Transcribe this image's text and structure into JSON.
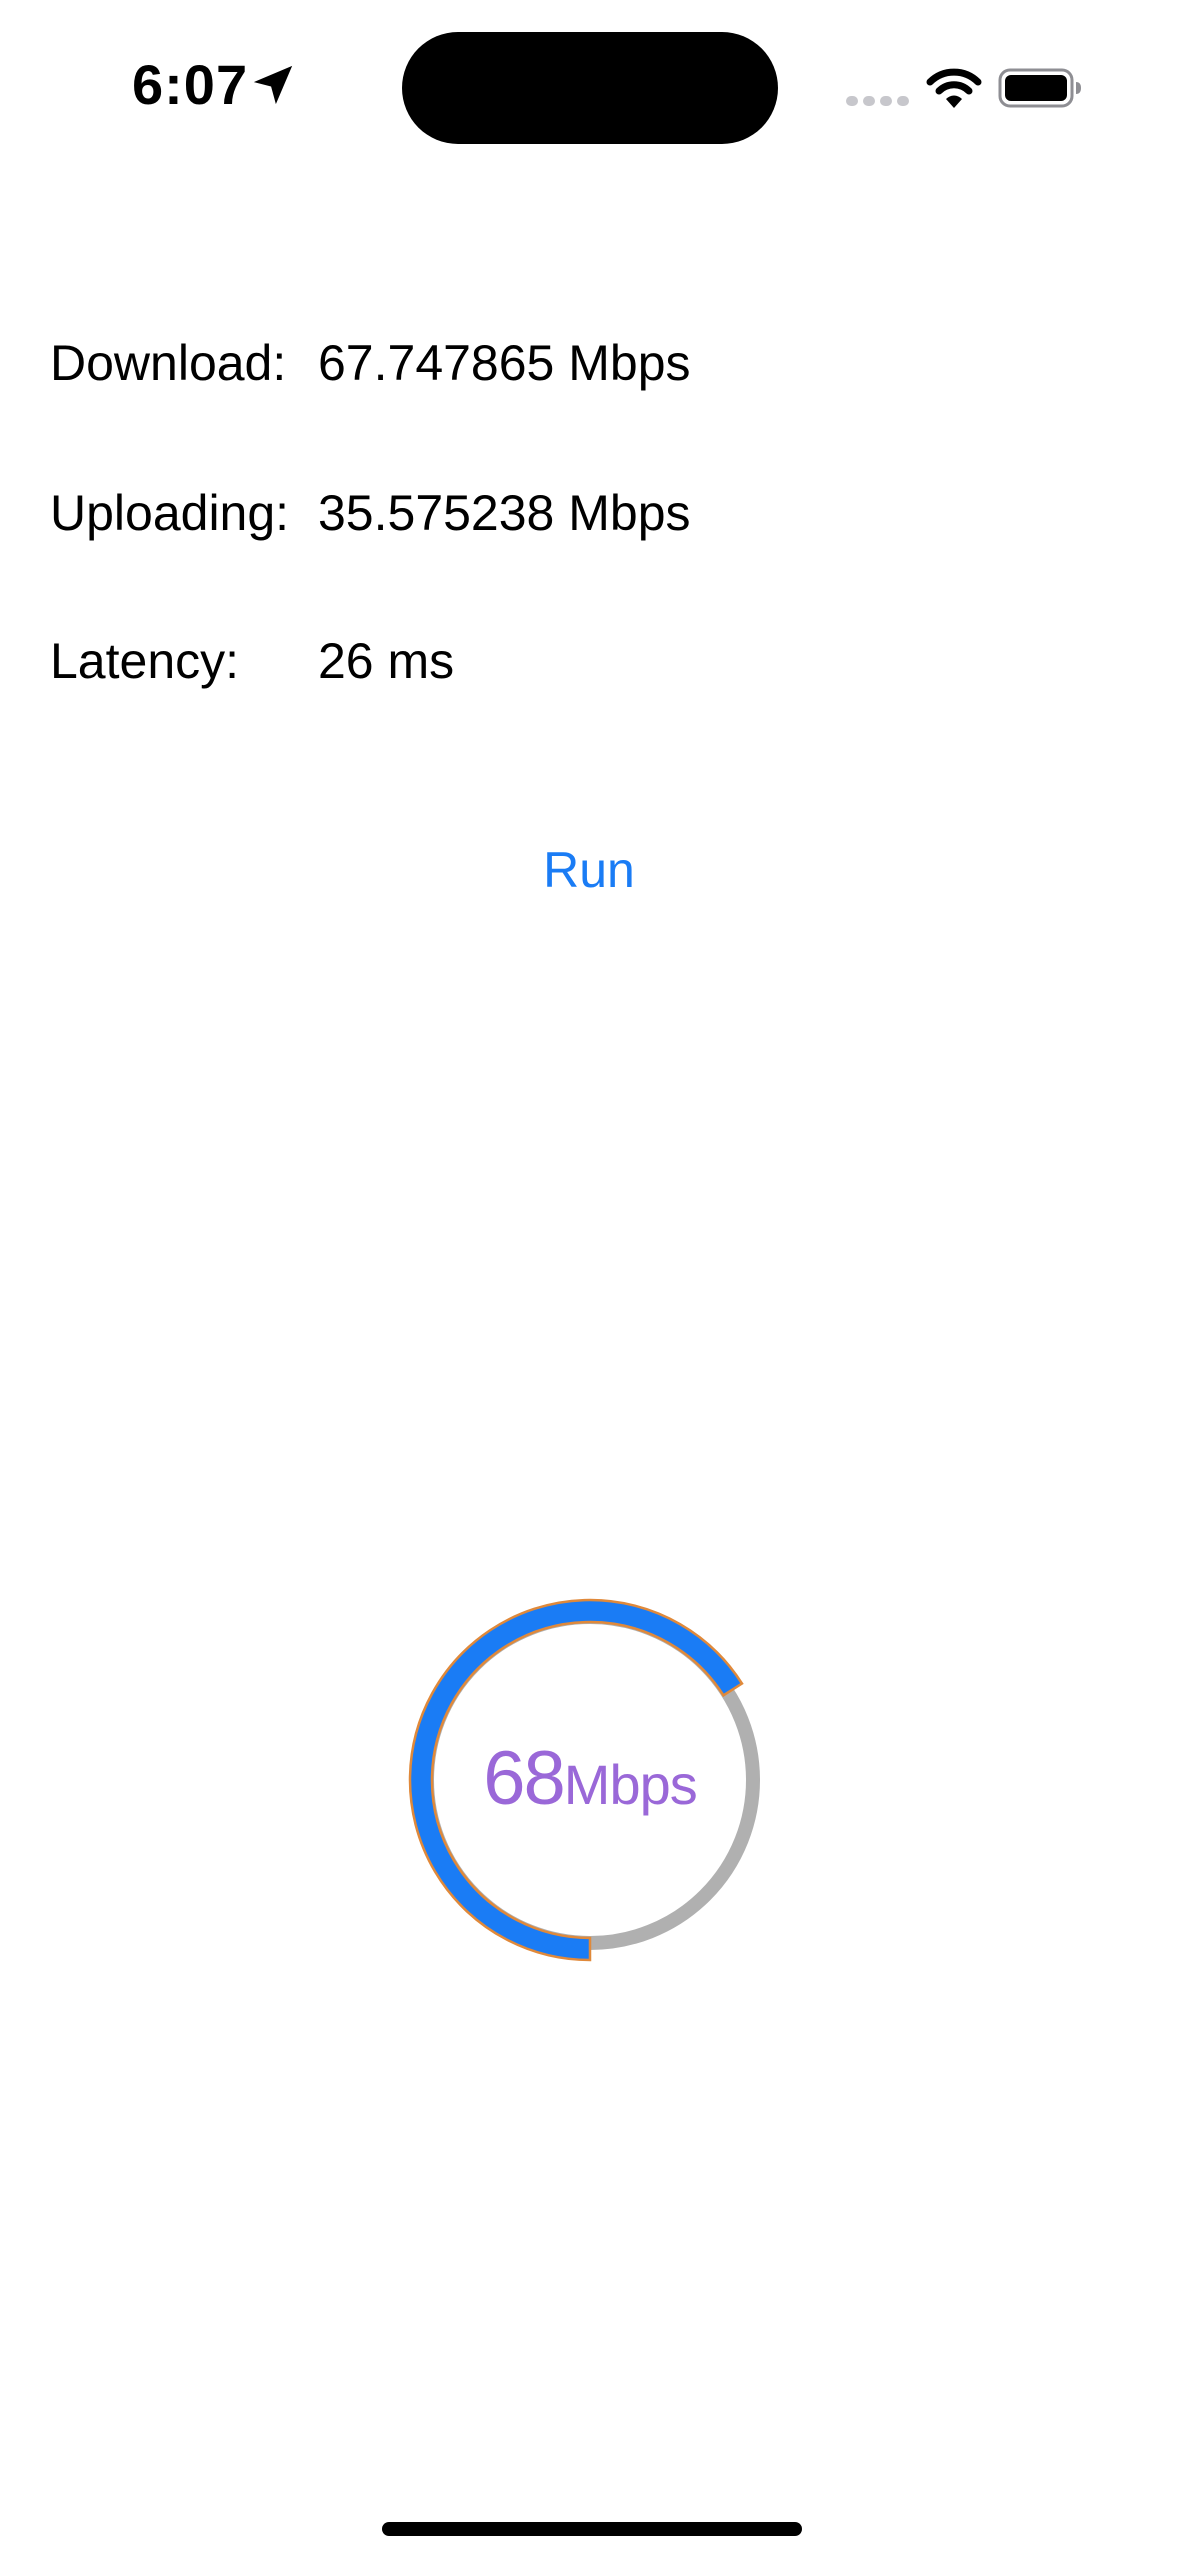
{
  "status_bar": {
    "time": "6:07",
    "icons": [
      "location-arrow-icon",
      "cellular-signal-icon",
      "wifi-icon",
      "battery-icon"
    ]
  },
  "stats": [
    {
      "label": "Download:",
      "value": "67.747865 Mbps"
    },
    {
      "label": "Uploading:",
      "value": "35.575238 Mbps"
    },
    {
      "label": "Latency:",
      "value": "26 ms"
    }
  ],
  "run_button": {
    "label": "Run"
  },
  "gauge": {
    "value": "68",
    "unit": "Mbps",
    "progress_fraction": 0.66,
    "colors": {
      "progress": "#1a7cf5",
      "progress_outline": "#e0893a",
      "track": "#b0b0b0",
      "label": "#9a68d8"
    }
  },
  "colors": {
    "accent": "#1a7cf5",
    "text": "#000000",
    "background": "#ffffff"
  }
}
